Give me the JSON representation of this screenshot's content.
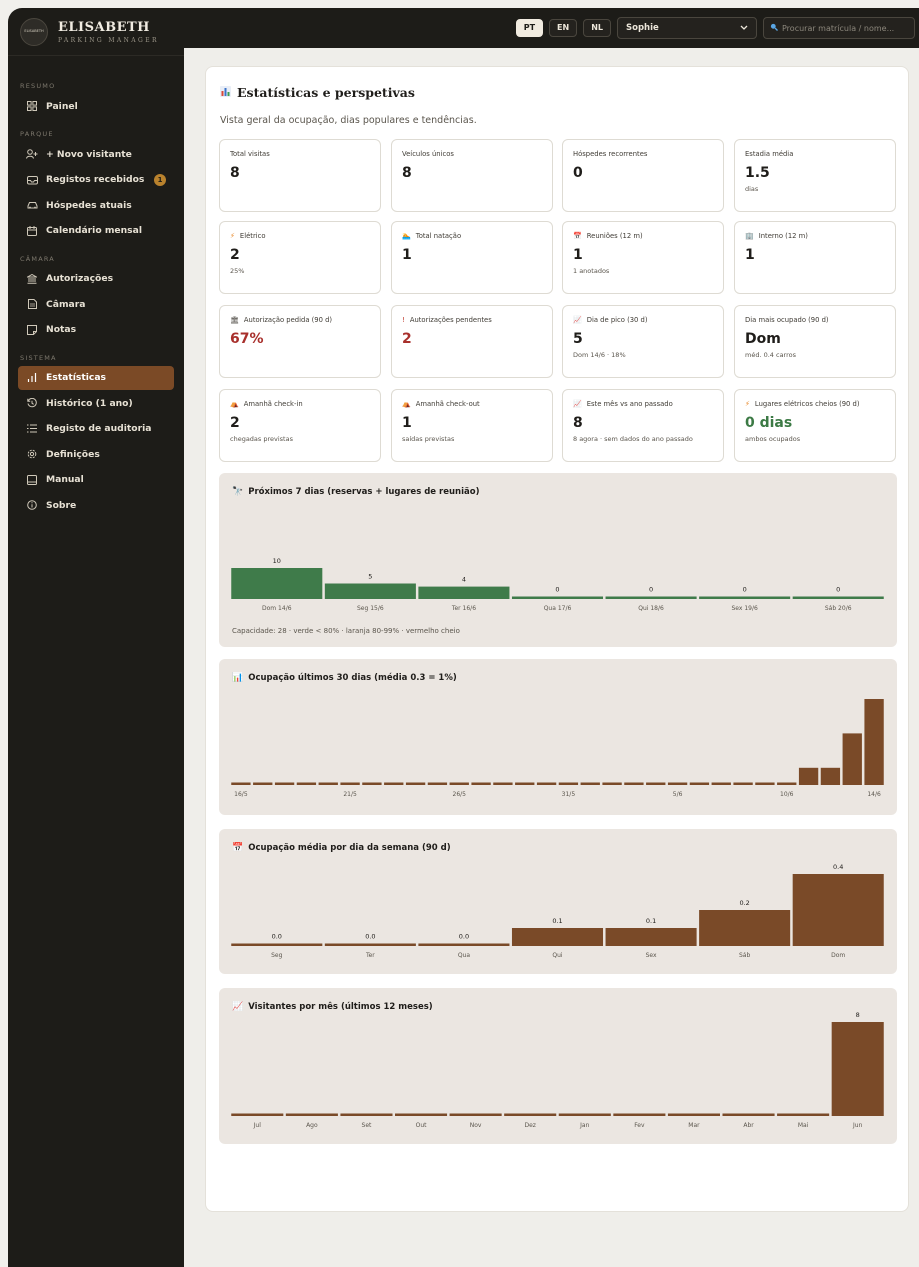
{
  "brand": {
    "logo_text": "ELISABETH",
    "name": "ELISABETH",
    "sub": "PARKING MANAGER"
  },
  "nav": {
    "sections": [
      "RESUMO",
      "PARQUE",
      "CÂMARA",
      "SISTEMA"
    ],
    "items": [
      {
        "label": "Painel",
        "icon": "dashboard-icon"
      },
      {
        "label": "+ Novo visitante",
        "icon": "add-user-icon"
      },
      {
        "label": "Registos recebidos",
        "icon": "inbox-icon",
        "badge": "1"
      },
      {
        "label": "Hóspedes atuais",
        "icon": "car-icon"
      },
      {
        "label": "Calendário mensal",
        "icon": "calendar-icon"
      },
      {
        "label": "Autorizações",
        "icon": "bank-icon"
      },
      {
        "label": "Câmara",
        "icon": "document-icon"
      },
      {
        "label": "Notas",
        "icon": "note-icon"
      },
      {
        "label": "Estatísticas",
        "icon": "bar-chart-icon",
        "active": true
      },
      {
        "label": "Histórico (1 ano)",
        "icon": "history-icon"
      },
      {
        "label": "Registo de auditoria",
        "icon": "list-icon"
      },
      {
        "label": "Definições",
        "icon": "gear-icon"
      },
      {
        "label": "Manual",
        "icon": "book-icon"
      },
      {
        "label": "Sobre",
        "icon": "info-icon"
      }
    ]
  },
  "topbar": {
    "langs": [
      "PT",
      "EN",
      "NL"
    ],
    "active_lang": "PT",
    "user": "Sophie",
    "search_placeholder": "Procurar matrícula / nome..."
  },
  "page": {
    "title": "Estatísticas e perspetivas",
    "subtitle": "Vista geral da ocupação, dias populares e tendências."
  },
  "stats": [
    {
      "label": "Total visitas",
      "value": "8",
      "sub": ""
    },
    {
      "label": "Veículos únicos",
      "value": "8",
      "sub": ""
    },
    {
      "label": "Hóspedes recorrentes",
      "value": "0",
      "sub": ""
    },
    {
      "label": "Estadia média",
      "value": "1.5",
      "sub": "dias"
    },
    {
      "label": "Elétrico",
      "icon": "⚡",
      "value": "2",
      "sub": "25%"
    },
    {
      "label": "Total natação",
      "icon": "🏊",
      "value": "1",
      "sub": ""
    },
    {
      "label": "Reuniões (12 m)",
      "icon": "📅",
      "value": "1",
      "sub": "1 anotados"
    },
    {
      "label": "Interno (12 m)",
      "icon": "🏢",
      "value": "1",
      "sub": ""
    },
    {
      "label": "Autorização pedida (90 d)",
      "icon": "🏛",
      "value": "67%",
      "sub": "",
      "style": "red"
    },
    {
      "label": "Autorizações pendentes",
      "icon": "!",
      "value": "2",
      "sub": "",
      "style": "red"
    },
    {
      "label": "Dia de pico (30 d)",
      "icon": "📈",
      "value": "5",
      "sub": "Dom 14/6 · 18%"
    },
    {
      "label": "Dia mais ocupado (90 d)",
      "value": "Dom",
      "sub": "méd. 0.4 carros"
    },
    {
      "label": "Amanhã check-in",
      "icon": "⛺",
      "value": "2",
      "sub": "chegadas previstas"
    },
    {
      "label": "Amanhã check-out",
      "icon": "⛺",
      "value": "1",
      "sub": "saídas previstas"
    },
    {
      "label": "Este mês vs ano passado",
      "icon": "📈",
      "value": "8",
      "sub": "8 agora · sem dados do ano passado"
    },
    {
      "label": "Lugares elétricos cheios (90 d)",
      "icon": "⚡",
      "value": "0 dias",
      "sub": "ambos ocupados",
      "style": "green"
    }
  ],
  "panels": {
    "next7": {
      "title": "Próximos 7 dias (reservas + lugares de reunião)",
      "caption": "Capacidade: 28 · verde < 80% · laranja 80-99% · vermelho cheio"
    },
    "occ30": {
      "title": "Ocupação últimos 30 dias (média 0.3 = 1%)"
    },
    "weekday": {
      "title": "Ocupação média por dia da semana (90 d)"
    },
    "months": {
      "title": "Visitantes por mês (últimos 12 meses)"
    }
  },
  "chart_data": [
    {
      "type": "bar",
      "title": "Próximos 7 dias (reservas + lugares de reunião)",
      "categories": [
        "Dom 14/6",
        "Seg 15/6",
        "Ter 16/6",
        "Qua 17/6",
        "Qui 18/6",
        "Sex 19/6",
        "Sáb 20/6"
      ],
      "values": [
        10,
        5,
        4,
        0,
        0,
        0,
        0
      ],
      "color": "#3f7b4a",
      "ylim": [
        0,
        10
      ]
    },
    {
      "type": "bar",
      "title": "Ocupação últimos 30 dias (média 0.3 = 1%)",
      "categories": [
        "16/5",
        "17/5",
        "18/5",
        "19/5",
        "20/5",
        "21/5",
        "22/5",
        "23/5",
        "24/5",
        "25/5",
        "26/5",
        "27/5",
        "28/5",
        "29/5",
        "30/5",
        "31/5",
        "1/6",
        "2/6",
        "3/6",
        "4/6",
        "5/6",
        "6/6",
        "7/6",
        "8/6",
        "9/6",
        "10/6",
        "11/6",
        "12/6",
        "13/6",
        "14/6"
      ],
      "tick_labels": [
        "16/5",
        "21/5",
        "26/5",
        "31/5",
        "5/6",
        "10/6",
        "14/6"
      ],
      "values": [
        0,
        0,
        0,
        0,
        0,
        0,
        0,
        0,
        0,
        0,
        0,
        0,
        0,
        0,
        0,
        0,
        0,
        0,
        0,
        0,
        0,
        0,
        0,
        0,
        0,
        0,
        1,
        1,
        3,
        5
      ],
      "color": "#7a4a28",
      "ylim": [
        0,
        5
      ]
    },
    {
      "type": "bar",
      "title": "Ocupação média por dia da semana (90 d)",
      "categories": [
        "Seg",
        "Ter",
        "Qua",
        "Qui",
        "Sex",
        "Sáb",
        "Dom"
      ],
      "values": [
        0.0,
        0.0,
        0.0,
        0.1,
        0.1,
        0.2,
        0.4
      ],
      "labels": [
        "0.0",
        "0.0",
        "0.0",
        "0.1",
        "0.1",
        "0.2",
        "0.4"
      ],
      "color": "#7a4a28",
      "ylim": [
        0,
        0.4
      ]
    },
    {
      "type": "bar",
      "title": "Visitantes por mês (últimos 12 meses)",
      "categories": [
        "Jul",
        "Ago",
        "Set",
        "Out",
        "Nov",
        "Dez",
        "Jan",
        "Fev",
        "Mar",
        "Abr",
        "Mai",
        "Jun"
      ],
      "values": [
        0,
        0,
        0,
        0,
        0,
        0,
        0,
        0,
        0,
        0,
        0,
        8
      ],
      "labels": [
        "",
        "",
        "",
        "",
        "",
        "",
        "",
        "",
        "",
        "",
        "",
        "8"
      ],
      "color": "#7a4a28",
      "ylim": [
        0,
        8
      ]
    }
  ]
}
